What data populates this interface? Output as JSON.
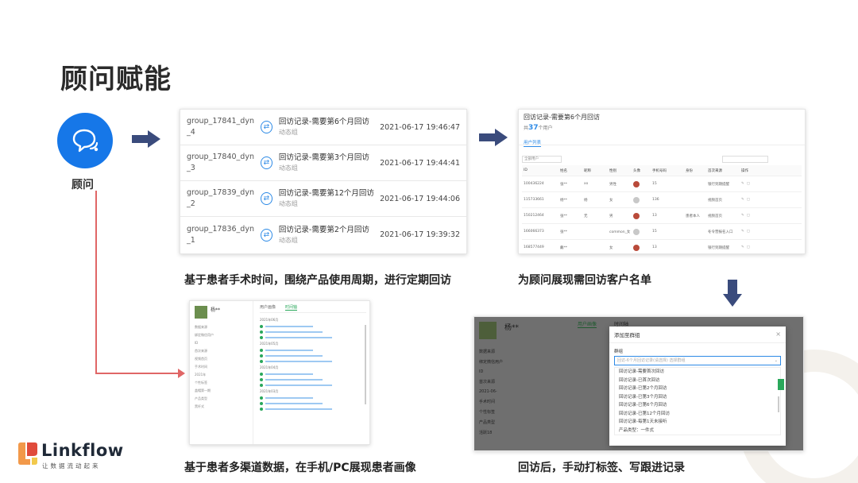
{
  "title": "顾问赋能",
  "advisor": {
    "label": "顾问",
    "icon": "chat-bubbles-icon"
  },
  "colors": {
    "accent_blue": "#1677e8",
    "arrow_navy": "#3a4b7c",
    "connector_red": "#e06666",
    "link_blue": "#2d8ae6",
    "green": "#2aa85b"
  },
  "groups": [
    {
      "id": "group_17841_dyn_4",
      "id_line1": "group_17841_dyn",
      "id_line2": "_4",
      "name": "回访记录-需要第6个月回访",
      "sub": "动态组",
      "time": "2021-06-17 19:46:47"
    },
    {
      "id": "group_17840_dyn_3",
      "id_line1": "group_17840_dyn",
      "id_line2": "_3",
      "name": "回访记录-需要第3个月回访",
      "sub": "动态组",
      "time": "2021-06-17 19:44:41"
    },
    {
      "id": "group_17839_dyn_2",
      "id_line1": "group_17839_dyn",
      "id_line2": "_2",
      "name": "回访记录-需要第12个月回访",
      "sub": "动态组",
      "time": "2021-06-17 19:44:06"
    },
    {
      "id": "group_17836_dyn_1",
      "id_line1": "group_17836_dyn",
      "id_line2": "_1",
      "name": "回访记录-需要第2个月回访",
      "sub": "动态组",
      "time": "2021-06-17 19:39:32"
    }
  ],
  "customer_list": {
    "title": "回访记录-需要第6个月回访",
    "count": "37",
    "count_unit": "个用户",
    "tab": "用户列表",
    "filter": "全部用户",
    "headers": [
      "ID",
      "姓名",
      "昵称",
      "性别",
      "头像",
      "手机号码",
      "身份",
      "首次来源",
      "操作"
    ],
    "rows": [
      {
        "id": "100436224",
        "name": "张**",
        "nick": "xx",
        "gender": "男性",
        "phone": "15",
        "identity": "",
        "source": "银行到期提醒"
      },
      {
        "id": "115733661",
        "name": "杨**",
        "nick": "杨",
        "gender": "女",
        "phone": "136",
        "identity": "",
        "source": "视频首页"
      },
      {
        "id": "150212464",
        "name": "张**",
        "nick": "无",
        "gender": "男",
        "phone": "13",
        "identity": "患者本人",
        "source": "视频首页"
      },
      {
        "id": "166066373",
        "name": "张**",
        "nick": "",
        "gender": "common_女",
        "phone": "15",
        "identity": "",
        "source": "冬令营报名入口"
      },
      {
        "id": "168577449",
        "name": "戴**",
        "nick": "",
        "gender": "女",
        "phone": "13",
        "identity": "",
        "source": "银行到期提醒"
      }
    ]
  },
  "profile": {
    "name": "杨**",
    "tabs": [
      "用户画像",
      "时间轴"
    ],
    "left_fields": [
      "数据来源",
      "绑定微信用户",
      "ID",
      "首次来源",
      "视频首页",
      "手术时间",
      "2021年",
      "个性标签",
      "盖帽第一期",
      "产品类型",
      "黑杆式"
    ],
    "timeline": [
      "2021年06月",
      "2021年05月",
      "2021年04月",
      "2021年03月"
    ]
  },
  "followup": {
    "name": "杨**",
    "tabs": [
      "用户画像",
      "时间轴"
    ],
    "modal_title": "添加至群组",
    "modal_label": "群组",
    "placeholder": "回访-6个月回访记录(请选择) 选择群组",
    "options": [
      "回访记录-需要首次回访",
      "回访记录-已首次回访",
      "回访记录-已第2个月回访",
      "回访记录-已第3个月回访",
      "回访记录-已第6个月回访",
      "回访记录-已第12个月回访",
      "回访记录-每第1天未接听",
      "产品类型：一件式"
    ],
    "bg_fields": [
      "数据来源",
      "绑定微信用户",
      "ID",
      "首次来源",
      "2021-06-",
      "手术时间",
      "个性标签",
      "产品类型",
      "活跃18"
    ]
  },
  "captions": {
    "list": "基于患者手术时间，围绕产品使用周期，进行定期回访",
    "customers": "为顾问展现需回访客户名单",
    "profile": "基于患者多渠道数据，在手机/PC展现患者画像",
    "followup": "回访后，手动打标签、写跟进记录"
  },
  "logo": {
    "name": "Linkflow",
    "tagline": "让数据流动起来"
  }
}
